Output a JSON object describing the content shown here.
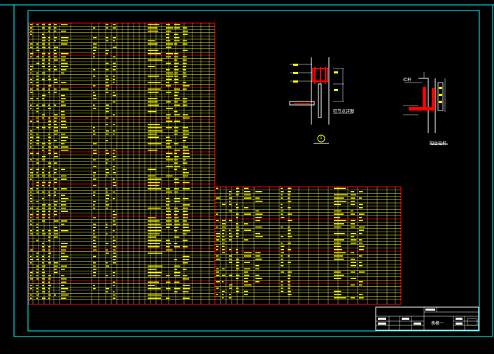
{
  "drawing": {
    "background": "#000000",
    "frame_color": "#00ffff",
    "table_border_color": "#ff0000",
    "row_line_color": "#ffff00",
    "text_color": "#ffff00"
  },
  "detail_1": {
    "caption": "柱节点详图",
    "marker": "1"
  },
  "detail_2": {
    "caption": "阳台栏杆",
    "note": "栏杆"
  },
  "title_block": {
    "drawing_title": "表格一"
  }
}
